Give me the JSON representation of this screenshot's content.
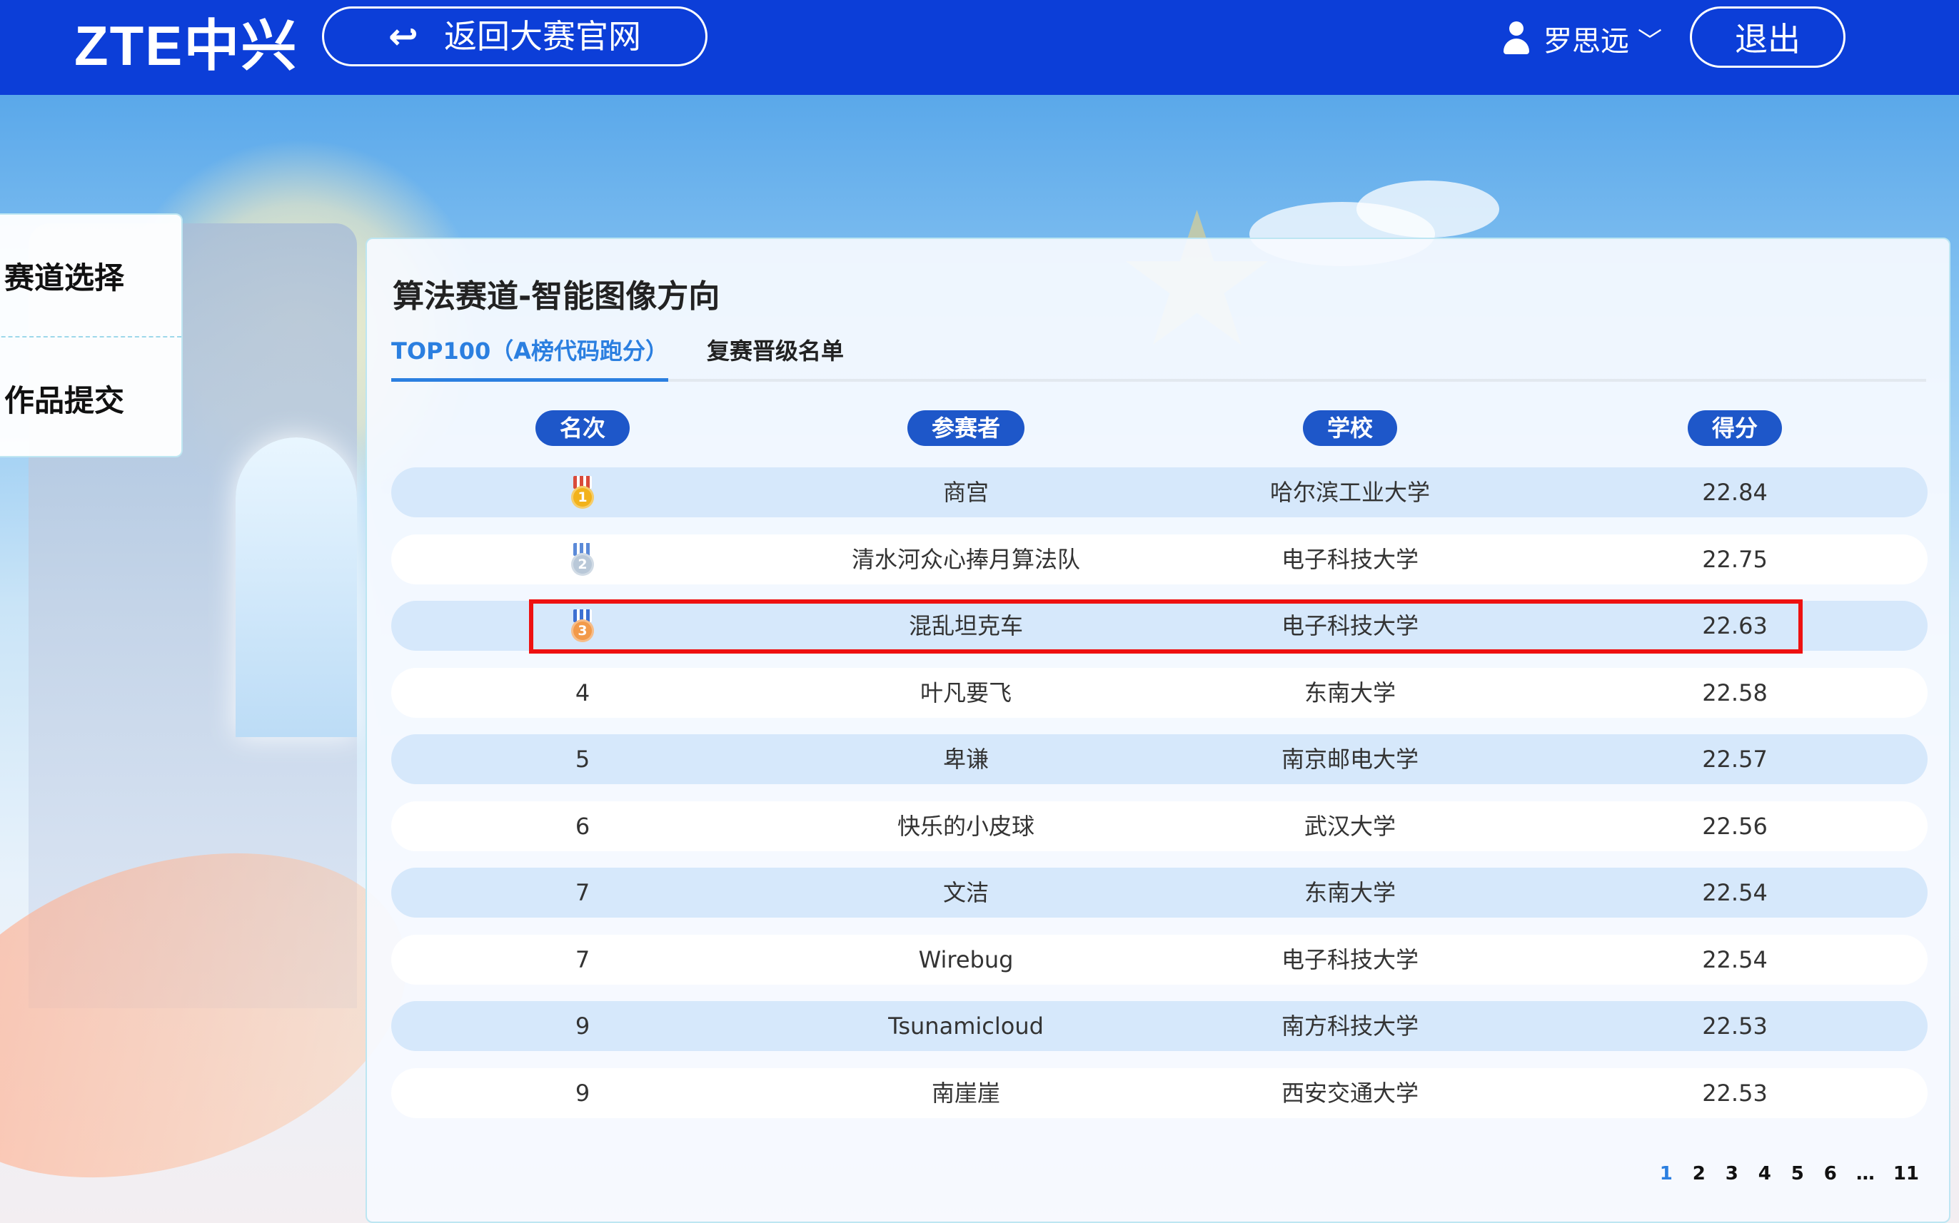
{
  "header": {
    "logo": "ZTE中兴",
    "back_button": "返回大赛官网",
    "user_name": "罗思远",
    "logout_button": "退出"
  },
  "sidemenu": {
    "items": [
      {
        "label": "赛道选择"
      },
      {
        "label": "作品提交"
      }
    ]
  },
  "panel": {
    "title": "算法赛道-智能图像方向",
    "tabs": [
      {
        "label": "TOP100（A榜代码跑分）",
        "active": true
      },
      {
        "label": "复赛晋级名单",
        "active": false
      }
    ],
    "columns": [
      "名次",
      "参赛者",
      "学校",
      "得分"
    ],
    "rows": [
      {
        "rank": "1",
        "medal": "gold",
        "name": "商宫",
        "school": "哈尔滨工业大学",
        "score": "22.84"
      },
      {
        "rank": "2",
        "medal": "silver",
        "name": "清水河众心捧月算法队",
        "school": "电子科技大学",
        "score": "22.75"
      },
      {
        "rank": "3",
        "medal": "bronze",
        "name": "混乱坦克车",
        "school": "电子科技大学",
        "score": "22.63"
      },
      {
        "rank": "4",
        "medal": "",
        "name": "叶凡要飞",
        "school": "东南大学",
        "score": "22.58"
      },
      {
        "rank": "5",
        "medal": "",
        "name": "卑谦",
        "school": "南京邮电大学",
        "score": "22.57"
      },
      {
        "rank": "6",
        "medal": "",
        "name": "快乐的小皮球",
        "school": "武汉大学",
        "score": "22.56"
      },
      {
        "rank": "7",
        "medal": "",
        "name": "文洁",
        "school": "东南大学",
        "score": "22.54"
      },
      {
        "rank": "7",
        "medal": "",
        "name": "Wirebug",
        "school": "电子科技大学",
        "score": "22.54"
      },
      {
        "rank": "9",
        "medal": "",
        "name": "Tsunamicloud",
        "school": "南方科技大学",
        "score": "22.53"
      },
      {
        "rank": "9",
        "medal": "",
        "name": "南崖崖",
        "school": "西安交通大学",
        "score": "22.53"
      }
    ],
    "highlighted_row": 3,
    "pagination": {
      "current": "1",
      "pages": [
        "1",
        "2",
        "3",
        "4",
        "5",
        "6",
        "…",
        "11"
      ]
    }
  },
  "colors": {
    "header_bg": "#0c3ed8",
    "accent": "#2b7fe0",
    "column_pill": "#1e57c9",
    "row_stripe": "#d6e8fb",
    "highlight_border": "#ee1111",
    "medal_gold": "#f2b21b",
    "medal_silver": "#b9c8d8",
    "medal_bronze": "#f29a4a"
  }
}
